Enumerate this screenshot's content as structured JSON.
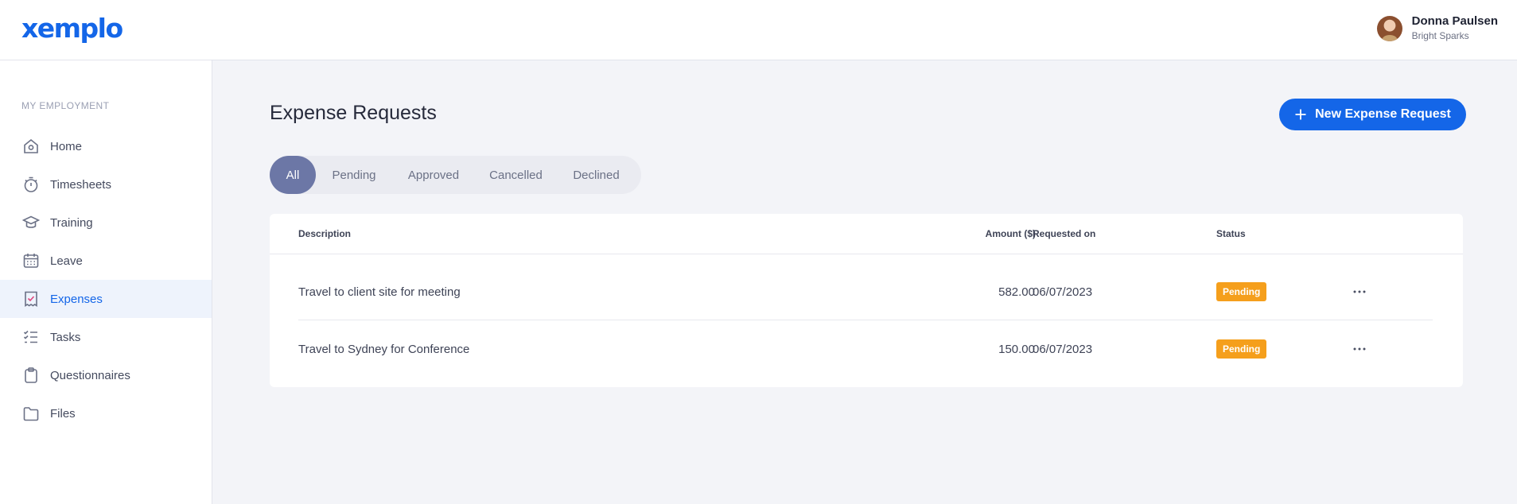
{
  "brand": {
    "logo_text": "xemplo",
    "accent": "#1466e8"
  },
  "user": {
    "name": "Donna Paulsen",
    "company": "Bright Sparks"
  },
  "sidebar": {
    "heading": "MY EMPLOYMENT",
    "items": [
      {
        "label": "Home",
        "icon": "home-icon"
      },
      {
        "label": "Timesheets",
        "icon": "stopwatch-icon"
      },
      {
        "label": "Training",
        "icon": "graduation-cap-icon"
      },
      {
        "label": "Leave",
        "icon": "calendar-icon"
      },
      {
        "label": "Expenses",
        "icon": "receipt-icon",
        "active": true
      },
      {
        "label": "Tasks",
        "icon": "task-list-icon"
      },
      {
        "label": "Questionnaires",
        "icon": "clipboard-icon"
      },
      {
        "label": "Files",
        "icon": "folder-icon"
      }
    ]
  },
  "page": {
    "title": "Expense Requests",
    "new_button_label": "New Expense Request"
  },
  "filters": {
    "tabs": [
      "All",
      "Pending",
      "Approved",
      "Cancelled",
      "Declined"
    ],
    "active": "All"
  },
  "table": {
    "headers": {
      "description": "Description",
      "amount": "Amount ($)",
      "requested_on": "Requested on",
      "status": "Status"
    },
    "rows": [
      {
        "description": "Travel to client site for meeting",
        "amount": "582.00",
        "requested_on": "06/07/2023",
        "status": "Pending"
      },
      {
        "description": "Travel to Sydney for Conference",
        "amount": "150.00",
        "requested_on": "06/07/2023",
        "status": "Pending"
      }
    ]
  },
  "colors": {
    "pending_badge": "#f59f1c",
    "active_filter": "#6c77a6"
  }
}
